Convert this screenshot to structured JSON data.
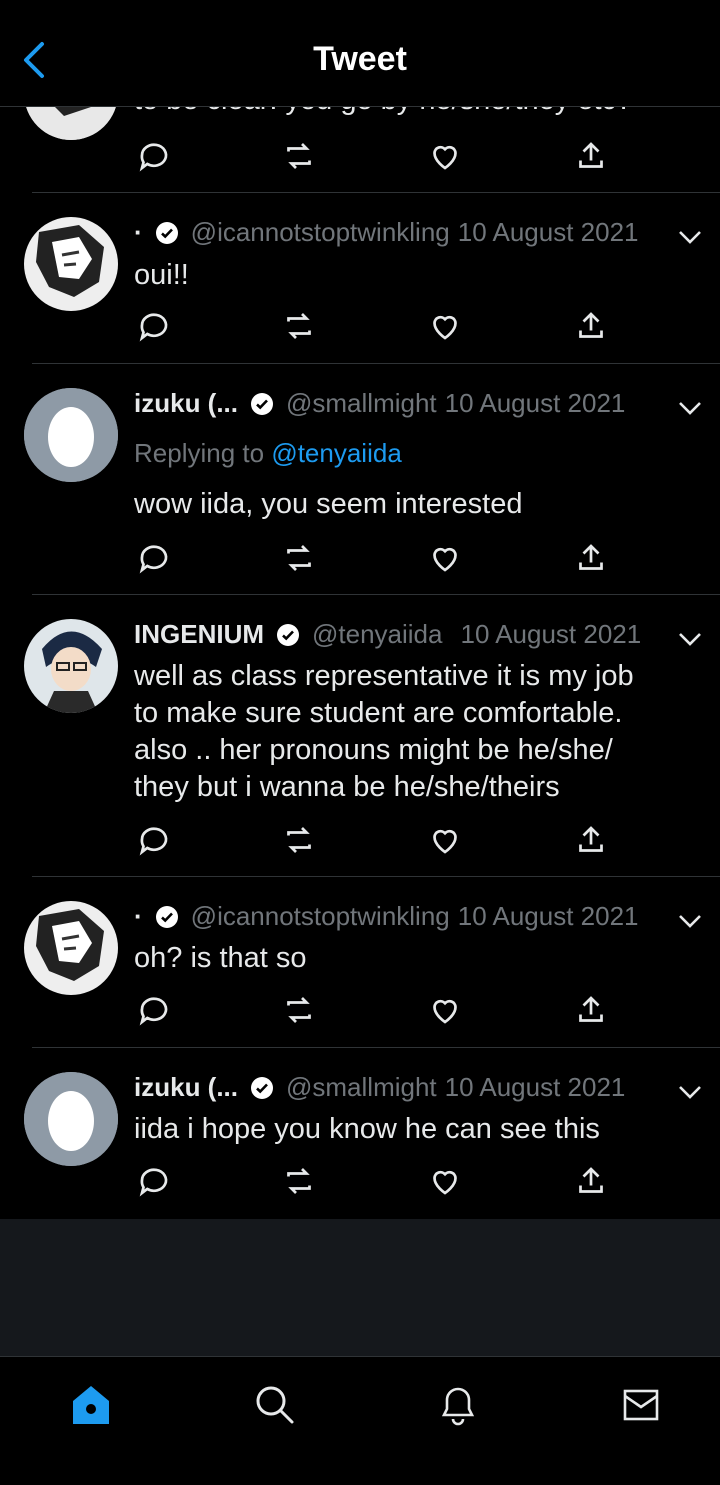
{
  "header": {
    "title": "Tweet",
    "back_icon": "chevron-left-icon"
  },
  "colors": {
    "accent": "#1d9bf0",
    "background": "#000000",
    "muted": "#71767b",
    "text": "#e7e9ea",
    "separator": "#2f3336"
  },
  "partial_tweet": {
    "body": "to be clear: you go by he/she/they etc?"
  },
  "tweets": [
    {
      "name": "·",
      "handle": "@icannotstoptwinkling",
      "date": "10 August 2021",
      "verified": true,
      "body": [
        "oui!!"
      ],
      "avatar": "anime-character-avatar"
    },
    {
      "name": "izuku (...",
      "handle": "@smallmight",
      "date": "10 August 2021",
      "verified": true,
      "replying_prefix": "Replying to",
      "replying_handle": "@tenyaiida",
      "body": [
        "wow iida, you seem interested"
      ],
      "avatar": "default-egg-avatar"
    },
    {
      "name": "INGENIUM",
      "handle": "@tenyaiida",
      "date": "10 August 2021",
      "verified": true,
      "body": [
        "well as class representative it is my job",
        "to make sure student are comfortable.",
        "also .. her pronouns might be he/she/",
        "they but i wanna be he/she/theirs"
      ],
      "avatar": "anime-character-avatar"
    },
    {
      "name": "·",
      "handle": "@icannotstoptwinkling",
      "date": "10 August 2021",
      "verified": true,
      "body": [
        "oh? is that so"
      ],
      "avatar": "anime-character-avatar"
    },
    {
      "name": "izuku (...",
      "handle": "@smallmight",
      "date": "10 August 2021",
      "verified": true,
      "body": [
        "iida i hope you know he can see this"
      ],
      "avatar": "default-egg-avatar"
    }
  ],
  "tabbar": {
    "items": [
      "home-icon",
      "search-icon",
      "notifications-bell-icon",
      "messages-envelope-icon"
    ],
    "active": "home-icon"
  }
}
